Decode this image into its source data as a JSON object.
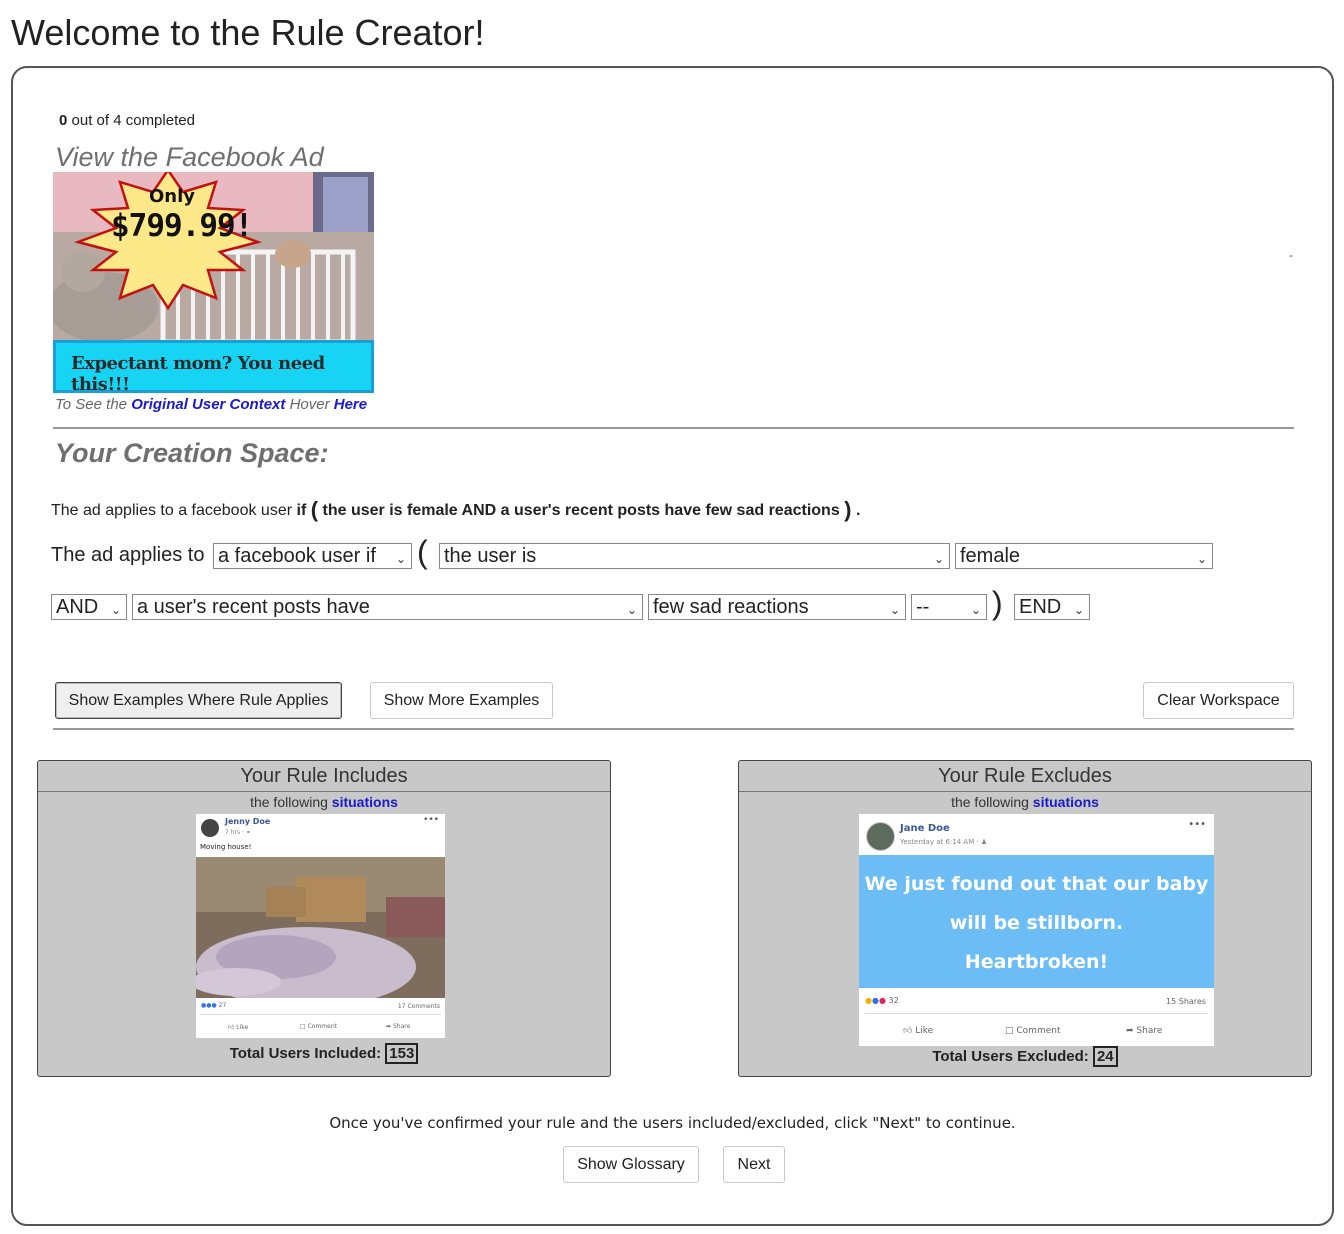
{
  "page": {
    "title": "Welcome to the Rule Creator!"
  },
  "progress": {
    "completed": "0",
    "rest": "out of 4 completed"
  },
  "ad": {
    "heading": "View the Facebook Ad",
    "burst_top": "Only",
    "price": "$799.99!",
    "banner": "Expectant mom? You need this!!!",
    "hint_prefix": "To See the",
    "hint_link": "Original User Context",
    "hint_mid": "Hover",
    "hint_here": "Here"
  },
  "dash": "-",
  "creation": {
    "heading": "Your Creation Space:",
    "summary_plain": "The ad applies to a facebook user",
    "summary_if": "if",
    "summary_open": "(",
    "summary_rule": "the user is female AND a user's recent posts have few sad reactions",
    "summary_close": ")",
    "summary_dot": ".",
    "applies_label": "The ad applies to",
    "selects": {
      "subject": "a facebook user if",
      "attr1": "the user is",
      "val1": "female",
      "conj": "AND",
      "attr2": "a user's recent posts have",
      "val2": "few sad reactions",
      "extra": "--",
      "end": "END"
    },
    "open_paren": "(",
    "close_paren": ")"
  },
  "buttons": {
    "show_examples": "Show Examples Where Rule Applies",
    "show_more": "Show More Examples",
    "clear": "Clear Workspace",
    "glossary": "Show Glossary",
    "next": "Next"
  },
  "includes": {
    "title": "Your Rule Includes",
    "sub_prefix": "the following",
    "sub_link": "situations",
    "total_label": "Total Users Included:",
    "total": "153",
    "post": {
      "name": "Jenny Doe",
      "time": "7 hrs · ",
      "text": "Moving house!",
      "reactions": "27",
      "comments": "17 Comments",
      "like": "Like",
      "comment": "Comment",
      "share": "Share"
    }
  },
  "excludes": {
    "title": "Your Rule Excludes",
    "sub_prefix": "the following",
    "sub_link": "situations",
    "total_label": "Total Users Excluded:",
    "total": "24",
    "post": {
      "name": "Jane Doe",
      "time": "Yesterday at 6:14 AM · ",
      "line1": "We just found out that our baby",
      "line2": "will be stillborn.",
      "line3": "Heartbroken!",
      "reactions": "32",
      "shares": "15 Shares",
      "like": "Like",
      "comment": "Comment",
      "share": "Share",
      "bg_color": "#6cbdf5"
    }
  },
  "footer": {
    "message": "Once you've confirmed your rule and the users included/excluded, click \"Next\" to continue."
  }
}
